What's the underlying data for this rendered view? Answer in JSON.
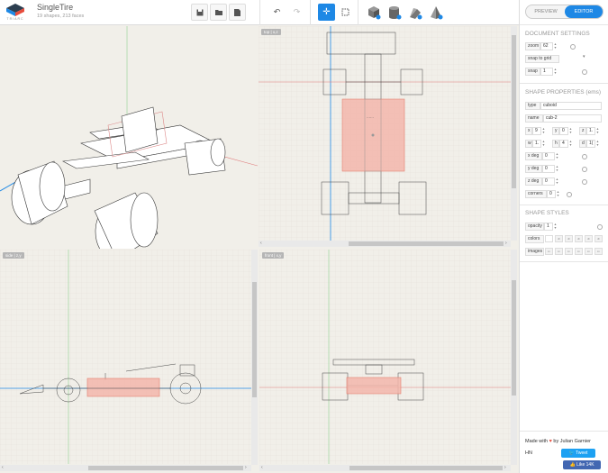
{
  "app": {
    "title": "SingleTire",
    "subtitle": "19 shapes, 213 faces",
    "logo_text": "TRIARC"
  },
  "toolbar": {
    "icons": [
      "save-icon",
      "open-folder-icon",
      "export-icon",
      "undo-icon",
      "redo-icon",
      "move-tool-icon",
      "select-box-icon",
      "add-cube-icon",
      "add-cylinder-icon",
      "add-wedge-icon",
      "add-pyramid-icon"
    ],
    "active_tool": "move-tool-icon",
    "accent": "#1e88e5"
  },
  "views": {
    "perspective": {
      "label": ""
    },
    "top": {
      "label": "top | x,z"
    },
    "side": {
      "label": "side | z,y"
    },
    "front": {
      "label": "front | x,y"
    }
  },
  "panel": {
    "tabs": {
      "preview": "PREVIEW",
      "editor": "EDITOR",
      "active": "EDITOR"
    },
    "doc": {
      "title": "DOCUMENT SETTINGS",
      "zoom_label": "zoom",
      "zoom_value": "62",
      "snap_grid": "snap to grid",
      "snap_label": "snap",
      "snap_value": "1"
    },
    "shape": {
      "title": "SHAPE PROPERTIES (ems)",
      "type_label": "type",
      "type_value": "cuboid",
      "name_label": "name",
      "name_value": "cub-2",
      "x_label": "x",
      "x_value": "9",
      "y_label": "y",
      "y_value": "0",
      "z_label": "z",
      "z_value": "1.",
      "w_label": "w",
      "w_value": "1.",
      "h_label": "h",
      "h_value": "4",
      "d_label": "d",
      "d_value": "1(",
      "xdeg_label": "x deg",
      "xdeg_value": "0",
      "ydeg_label": "y deg",
      "ydeg_value": "0",
      "zdeg_label": "z deg",
      "zdeg_value": "0",
      "corners_label": "corners",
      "corners_value": "0"
    },
    "styles": {
      "title": "SHAPE STYLES",
      "opacity_label": "opacity",
      "opacity_value": "1",
      "colors_label": "colors",
      "images_label": "images",
      "swatch_text": "dh",
      "img_text": "im"
    },
    "footer": {
      "made": "Made with",
      "heart": "♥",
      "by": "by Julian Garnier",
      "hn": "HN",
      "tweet": "Tweet",
      "like": "Like 14K"
    }
  }
}
